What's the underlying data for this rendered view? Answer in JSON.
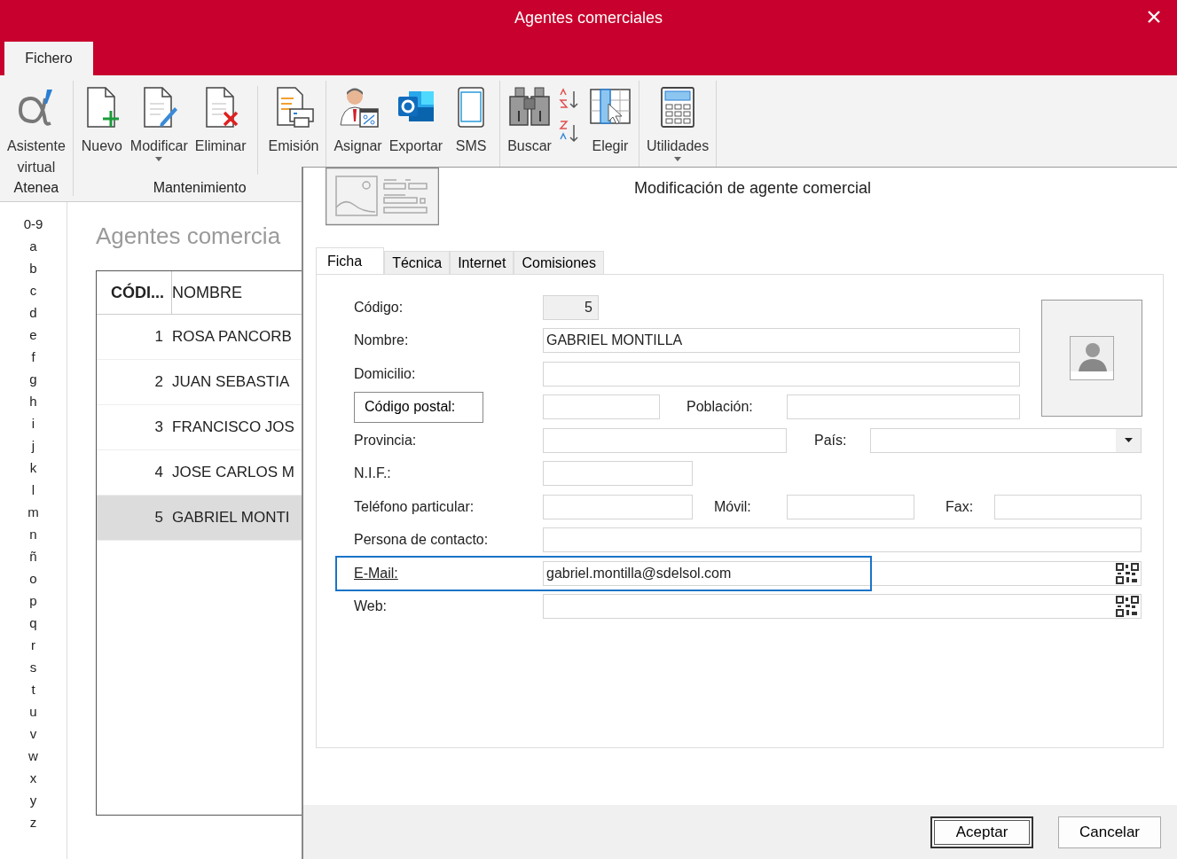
{
  "window": {
    "title": "Agentes comerciales"
  },
  "ribbon": {
    "tabs": [
      {
        "label": "Fichero",
        "selected": true
      }
    ],
    "groups": [
      {
        "label": "Atenea",
        "items": [
          {
            "kind": "alpha",
            "lines": [
              "Asistente",
              "virtual"
            ],
            "dropdown": false
          }
        ]
      },
      {
        "label": "Mantenimiento",
        "items": [
          {
            "kind": "new",
            "lines": [
              "Nuevo"
            ],
            "dropdown": false
          },
          {
            "kind": "edit",
            "lines": [
              "Modificar"
            ],
            "dropdown": true
          },
          {
            "kind": "delete",
            "lines": [
              "Eliminar"
            ],
            "dropdown": false
          },
          {
            "kind": "separator"
          },
          {
            "kind": "print",
            "lines": [
              "Emisión"
            ],
            "dropdown": false
          }
        ]
      },
      {
        "items": [
          {
            "kind": "agent",
            "lines": [
              "Asignar"
            ],
            "dropdown": false
          },
          {
            "kind": "outlook",
            "lines": [
              "Exportar"
            ],
            "dropdown": false
          },
          {
            "kind": "phone",
            "lines": [
              "SMS"
            ],
            "dropdown": false
          }
        ]
      },
      {
        "items": [
          {
            "kind": "binoculars",
            "lines": [
              "Buscar"
            ],
            "dropdown": false
          },
          {
            "kind": "sort"
          },
          {
            "kind": "columns",
            "lines": [
              "Elegir"
            ],
            "dropdown": false
          }
        ]
      },
      {
        "items": [
          {
            "kind": "calculator",
            "lines": [
              "Utilidades"
            ],
            "dropdown": true
          }
        ]
      }
    ]
  },
  "index": [
    "0-9",
    "a",
    "b",
    "c",
    "d",
    "e",
    "f",
    "g",
    "h",
    "i",
    "j",
    "k",
    "l",
    "m",
    "n",
    "ñ",
    "o",
    "p",
    "q",
    "r",
    "s",
    "t",
    "u",
    "v",
    "w",
    "x",
    "y",
    "z"
  ],
  "list": {
    "heading": "Agentes comercia",
    "columns": [
      "CÓDI...",
      "NOMBRE"
    ],
    "rows": [
      {
        "code": "1",
        "name": "ROSA PANCORB",
        "selected": false
      },
      {
        "code": "2",
        "name": "JUAN SEBASTIA",
        "selected": false
      },
      {
        "code": "3",
        "name": "FRANCISCO JOS",
        "selected": false
      },
      {
        "code": "4",
        "name": "JOSE CARLOS M",
        "selected": false
      },
      {
        "code": "5",
        "name": "GABRIEL MONTI",
        "selected": true
      }
    ]
  },
  "dialog": {
    "title": "Modificación de agente comercial",
    "tabs": [
      {
        "label": "Ficha",
        "selected": true
      },
      {
        "label": "Técnica",
        "selected": false
      },
      {
        "label": "Internet",
        "selected": false
      },
      {
        "label": "Comisiones",
        "selected": false
      }
    ],
    "form": {
      "codigo": {
        "label": "Código:",
        "value": "5"
      },
      "nombre": {
        "label": "Nombre:",
        "value": "GABRIEL MONTILLA"
      },
      "domicilio": {
        "label": "Domicilio:"
      },
      "codigo_postal": {
        "button": "Código postal:"
      },
      "poblacion": {
        "label": "Población:"
      },
      "provincia": {
        "label": "Provincia:"
      },
      "pais": {
        "label": "País:"
      },
      "nif": {
        "label": "N.I.F.:"
      },
      "telefono": {
        "label": "Teléfono particular:"
      },
      "movil": {
        "label": "Móvil:"
      },
      "fax": {
        "label": "Fax:"
      },
      "contacto": {
        "label": "Persona de contacto:"
      },
      "email": {
        "label": "E-Mail:",
        "value": "gabriel.montilla@sdelsol.com",
        "focused": true
      },
      "web": {
        "label": "Web:"
      }
    },
    "buttons": [
      {
        "label": "Aceptar",
        "default": true
      },
      {
        "label": "Cancelar",
        "default": false
      }
    ]
  }
}
